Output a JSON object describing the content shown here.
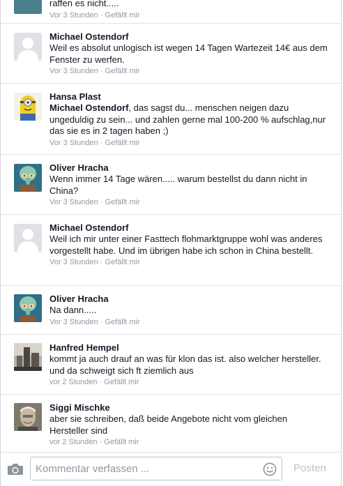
{
  "top_partial": {
    "text": "raffen es nicht.....",
    "time": "Vor 3 Stunden",
    "like": "Gefällt mir"
  },
  "comments": [
    {
      "author": "Michael Ostendorf",
      "mention": "",
      "text": "Weil es absolut unlogisch ist wegen 14 Tagen Wartezeit 14€ aus dem Fenster zu werfen.",
      "time": "Vor 3 Stunden",
      "like": "Gefällt mir",
      "avatar": "default-silhouette"
    },
    {
      "author": "Hansa Plast",
      "mention": "Michael Ostendorf",
      "text": ", das sagst du... menschen neigen dazu ungeduldig zu sein... und zahlen gerne mal 100-200 % aufschlag,nur das sie es in 2 tagen haben ;)",
      "time": "Vor 3 Stunden",
      "like": "Gefällt mir",
      "avatar": "minion"
    },
    {
      "author": "Oliver Hracha",
      "mention": "",
      "text": "Wenn immer 14 Tage wären..... warum bestellst du dann nicht in China?",
      "time": "Vor 3 Stunden",
      "like": "Gefällt mir",
      "avatar": "squidward"
    },
    {
      "author": "Michael Ostendorf",
      "mention": "",
      "text": "Weil ich mir unter einer Fasttech flohmarktgruppe wohl was anderes vorgestellt habe. Und im übrigen habe ich schon in China bestellt.",
      "time": "Vor 3 Stunden",
      "like": "Gefällt mir",
      "avatar": "default-silhouette"
    },
    {
      "author": "Oliver Hracha",
      "mention": "",
      "text": "Na dann.....",
      "time": "Vor 3 Stunden",
      "like": "Gefällt mir",
      "avatar": "squidward"
    },
    {
      "author": "Hanfred Hempel",
      "mention": "",
      "text": "kommt ja auch drauf an was für klon das ist. also welcher hersteller. und da schweigt sich ft ziemlich aus",
      "time": "vor 2 Stunden",
      "like": "Gefällt mir",
      "avatar": "city-photo"
    },
    {
      "author": "Siggi Mischke",
      "mention": "",
      "text": "aber sie schreiben, daß beide Angebote nicht vom gleichen Hersteller sind",
      "time": "vor 2 Stunden",
      "like": "Gefällt mir",
      "avatar": "portrait-photo"
    }
  ],
  "composer": {
    "placeholder": "Kommentar verfassen ...",
    "value": "",
    "post_label": "Posten",
    "camera_icon": "camera-icon",
    "emoji_icon": "smiley-icon"
  },
  "colors": {
    "text": "#141823",
    "meta": "#9197a3",
    "divider": "#e1e3e8",
    "post_disabled": "#bdc1c9"
  }
}
